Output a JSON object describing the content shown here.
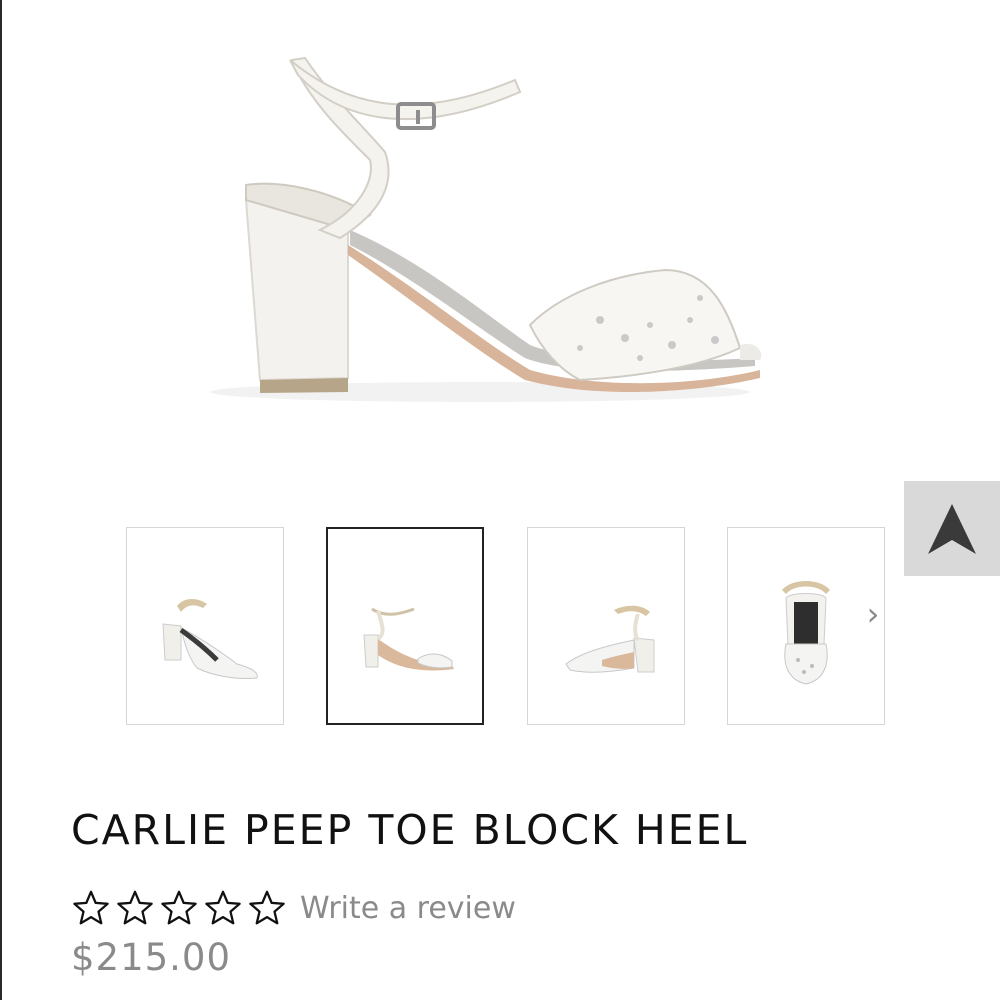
{
  "product": {
    "title": "CARLIE PEEP TOE BLOCK HEEL",
    "price": "$215.00",
    "rating": {
      "stars_filled": 0,
      "stars_total": 5,
      "write_review_label": "Write a review"
    }
  },
  "gallery": {
    "thumbnails": [
      {
        "view": "front three-quarter view",
        "selected": false
      },
      {
        "view": "side view",
        "selected": true
      },
      {
        "view": "back three-quarter view",
        "selected": false
      },
      {
        "view": "top view",
        "selected": false
      }
    ],
    "prev_icon": "chevron-left-icon",
    "next_icon": "chevron-right-icon"
  },
  "controls": {
    "scroll_top_icon": "arrow-up-icon"
  },
  "colors": {
    "accent": "#111111",
    "muted_text": "#8a8a8a",
    "scroll_button_bg": "#d9d9d9",
    "shoe_ivory": "#f3f1ec"
  }
}
